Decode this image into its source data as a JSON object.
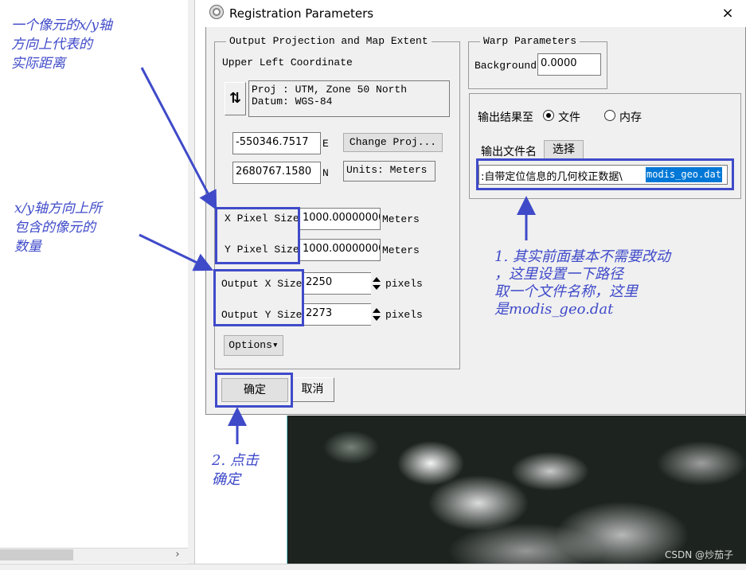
{
  "dialog": {
    "title": "Registration Parameters",
    "close_glyph": "×"
  },
  "output_group": {
    "legend": "Output Projection and Map Extent",
    "upper_left_label": "Upper Left Coordinate",
    "proj_line": "Proj : UTM, Zone 50 North",
    "datum_line": "Datum: WGS-84",
    "swap_glyph": "⇅",
    "easting_value": "-550346.7517",
    "easting_unit": "E",
    "northing_value": "2680767.1580",
    "northing_unit": "N",
    "change_proj_label": "Change Proj...",
    "units_label": "Units: Meters",
    "x_pixel_label": "X Pixel Size",
    "x_pixel_value": "1000.00000000",
    "x_pixel_unit": "Meters",
    "y_pixel_label": "Y Pixel Size",
    "y_pixel_value": "1000.00000000",
    "y_pixel_unit": "Meters",
    "out_x_label": "Output X Size",
    "out_x_value": "2250",
    "out_x_unit": "pixels",
    "out_y_label": "Output Y Size",
    "out_y_value": "2273",
    "out_y_unit": "pixels",
    "options_label": "Options▾"
  },
  "warp_group": {
    "legend": "Warp Parameters",
    "background_label": "Background",
    "background_value": "0.0000"
  },
  "output_dest": {
    "output_to_label": "输出结果至",
    "file_option": "文件",
    "memory_option": "内存",
    "file_selected": true,
    "filename_label": "输出文件名",
    "choose_label": "选择",
    "path_prefix": ":自带定位信息的几何校正数据\\",
    "path_selected": "modis_geo.dat"
  },
  "buttons": {
    "ok_label": "确定",
    "cancel_label": "取消"
  },
  "annotations": {
    "pixel_size_note": [
      "一个像元的x/y轴",
      "方向上代表的",
      "实际距离"
    ],
    "output_size_note": [
      "x/y轴方向上所",
      "包含的像元的",
      "数量"
    ],
    "step1_note": [
      "1. 其实前面基本不需要改动",
      "，这里设置一下路径",
      "取一个文件名称，这里",
      "是modis_geo.dat"
    ],
    "step2_note": [
      "2. 点击",
      "确定"
    ]
  },
  "background": {
    "scroll_right_glyph": "›",
    "watermark": "CSDN @炒茄子"
  },
  "colors": {
    "annotation": "#3f4ac9",
    "selection": "#0078d7"
  }
}
